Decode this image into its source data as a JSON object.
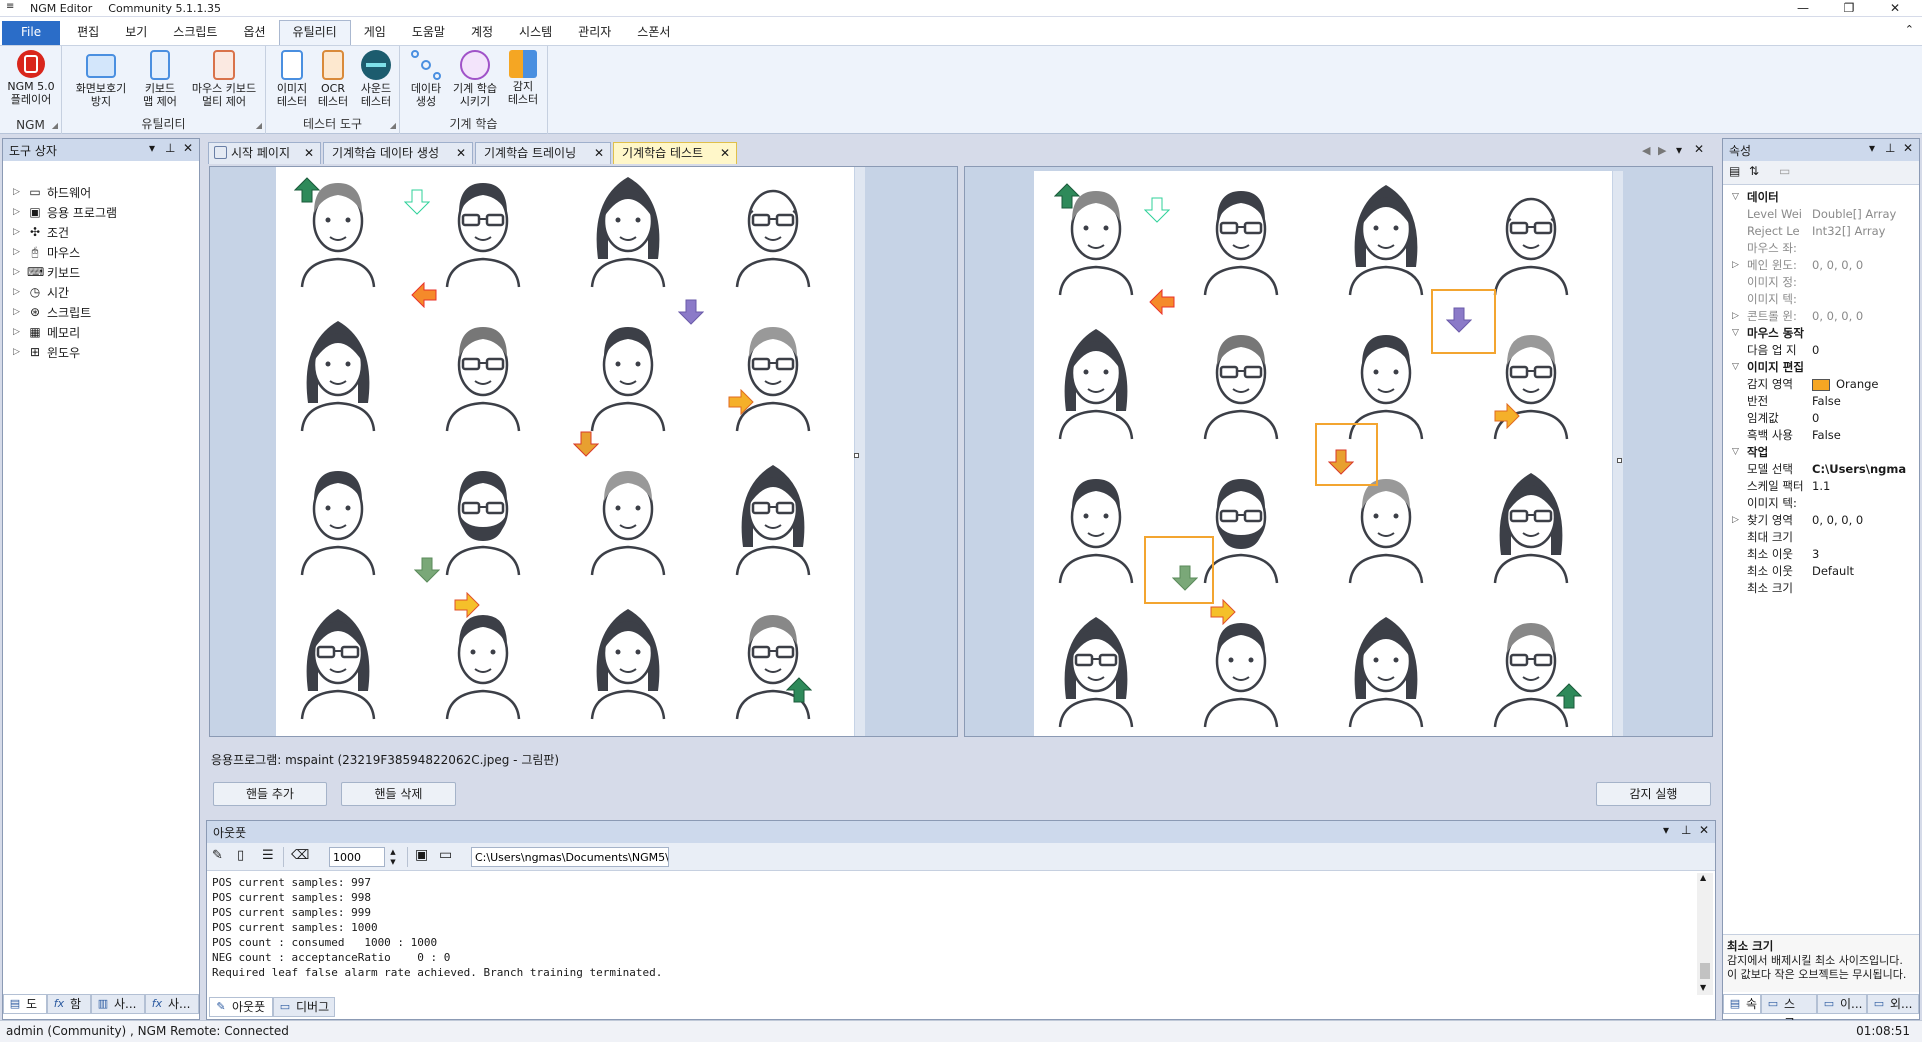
{
  "app": {
    "title": "NGM Editor",
    "edition": "Community 5.1.1.35",
    "minimize": "—",
    "restore": "❐",
    "close": "✕"
  },
  "menu": [
    "File",
    "편집",
    "보기",
    "스크립트",
    "옵션",
    "유틸리티",
    "게임",
    "도움말",
    "계정",
    "시스템",
    "관리자",
    "스폰서"
  ],
  "ribbon": {
    "groups": [
      {
        "label": "NGM",
        "buttons": [
          {
            "l1": "NGM 5.0",
            "l2": "플레이어"
          }
        ]
      },
      {
        "label": "유틸리티",
        "buttons": [
          {
            "l1": "화면보호기",
            "l2": "방지"
          },
          {
            "l1": "키보드",
            "l2": "맵 제어"
          },
          {
            "l1": "마우스 키보드",
            "l2": "멀티 제어"
          }
        ]
      },
      {
        "label": "테스터 도구",
        "buttons": [
          {
            "l1": "이미지",
            "l2": "테스터"
          },
          {
            "l1": "OCR",
            "l2": "테스터"
          },
          {
            "l1": "사운드",
            "l2": "테스터"
          }
        ]
      },
      {
        "label": "기계 학습",
        "buttons": [
          {
            "l1": "데이타",
            "l2": "생성"
          },
          {
            "l1": "기계 학습",
            "l2": "시키기"
          },
          {
            "l1": "감지",
            "l2": "테스터"
          }
        ]
      }
    ],
    "collapse": "⌃"
  },
  "toolbox": {
    "title": "도구 상자",
    "items": [
      "하드웨어",
      "응용 프로그램",
      "조건",
      "마우스",
      "키보드",
      "시간",
      "스크립트",
      "메모리",
      "윈도우"
    ],
    "bottom_tabs": [
      "도",
      "함",
      "사...",
      "사..."
    ]
  },
  "tabs": [
    "시작 페이지",
    "기계학습 데이타 생성",
    "기계학습 트레이닝",
    "기계학습 테스트"
  ],
  "active_tab": 3,
  "app_label": "응용프로그램: mspaint (23219F38594822062C.jpeg - 그림판)",
  "buttons": {
    "add_handle": "핸들 추가",
    "remove_handle": "핸들 삭제",
    "run_detect": "감지 실행"
  },
  "output": {
    "title": "아웃풋",
    "count_value": "1000",
    "path": "C:\\Users\\ngmas\\Documents\\NGM5\\",
    "lines": [
      "POS current samples: 997",
      "POS current samples: 998",
      "POS current samples: 999",
      "POS current samples: 1000",
      "POS count : consumed   1000 : 1000",
      "NEG count : acceptanceRatio    0 : 0",
      "Required leaf false alarm rate achieved. Branch training terminated."
    ],
    "bottom_tabs": [
      "아웃풋",
      "디버그"
    ]
  },
  "properties": {
    "title": "속성",
    "rows": [
      {
        "type": "cat",
        "k": "데이터"
      },
      {
        "k": "Level Wei",
        "v": "Double[] Array",
        "gray": true
      },
      {
        "k": "Reject Le",
        "v": "Int32[] Array",
        "gray": true
      },
      {
        "k": "마우스 좌:",
        "v": "",
        "gray": true
      },
      {
        "k": "메인 윈도:",
        "v": "0, 0, 0, 0",
        "gray": true,
        "exp": true
      },
      {
        "k": "이미지 정:",
        "v": "",
        "gray": true
      },
      {
        "k": "이미지 텍:",
        "v": "",
        "gray": true
      },
      {
        "k": "콘트롤 윈:",
        "v": "0, 0, 0, 0",
        "gray": true,
        "exp": true
      },
      {
        "type": "cat",
        "k": "마우스 동작"
      },
      {
        "k": "다음 업 지",
        "v": "0"
      },
      {
        "type": "cat",
        "k": "이미지 편집"
      },
      {
        "k": "감지 영역",
        "v": "Orange",
        "swatch": "#f5a623"
      },
      {
        "k": "반전",
        "v": "False"
      },
      {
        "k": "임계값",
        "v": "0"
      },
      {
        "k": "흑백 사용",
        "v": "False"
      },
      {
        "type": "cat",
        "k": "작업"
      },
      {
        "k": "모델 선택",
        "v": "C:\\Users\\ngma",
        "bold": true
      },
      {
        "k": "스케일 팩터",
        "v": "1.1"
      },
      {
        "k": "이미지 텍:",
        "v": ""
      },
      {
        "k": "찾기 영역",
        "v": "0, 0, 0, 0",
        "exp": true
      },
      {
        "k": "최대 크기",
        "v": ""
      },
      {
        "k": "최소 이웃",
        "v": "3"
      },
      {
        "k": "최소 이웃",
        "v": "Default"
      },
      {
        "k": "최소 크기",
        "v": ""
      }
    ],
    "desc_title": "최소 크기",
    "desc_text": "감지에서 배제시킬 최소 사이즈입니다. 이 값보다 작은 오브젝트는 무시됩니다.",
    "bottom_tabs": [
      "속",
      "스크...",
      "이...",
      "외..."
    ]
  },
  "status": {
    "left": "admin (Community) , NGM Remote: Connected",
    "time": "01:08:51"
  }
}
